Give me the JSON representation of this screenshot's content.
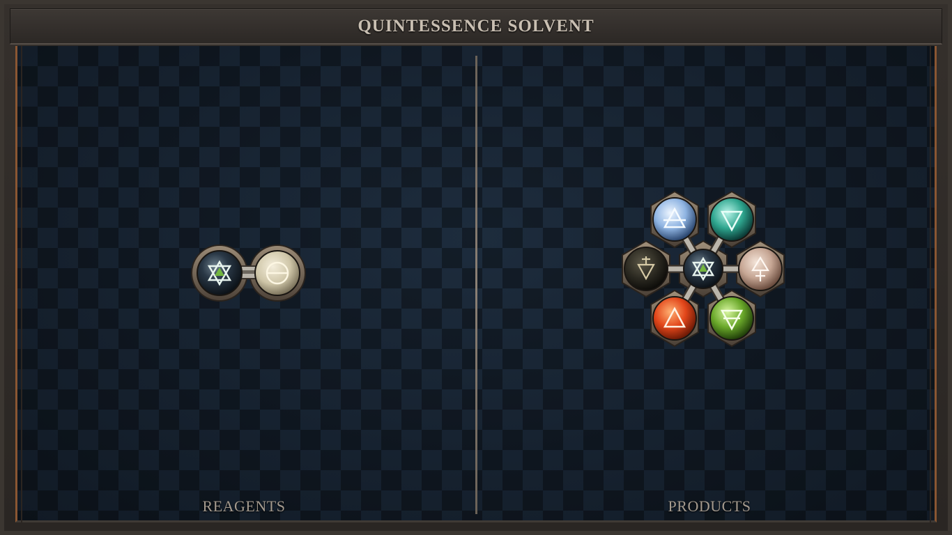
{
  "title": "QUINTESSENCE SOLVENT",
  "panels": {
    "reagents": {
      "label": "REAGENTS",
      "atoms": [
        {
          "element": "quintessence",
          "icon": "quintessence-icon",
          "color": "#3a4a58"
        },
        {
          "element": "salt",
          "icon": "salt-icon",
          "color": "#d8d0b8"
        }
      ]
    },
    "products": {
      "label": "PRODUCTS",
      "atoms": [
        {
          "element": "air",
          "icon": "air-icon",
          "color": "#a8c8ee"
        },
        {
          "element": "water",
          "icon": "water-icon",
          "color": "#3aa890"
        },
        {
          "element": "lead",
          "icon": "lead-icon",
          "color": "#2a2820"
        },
        {
          "element": "quintessence",
          "icon": "quintessence-icon",
          "color": "#3a4a58"
        },
        {
          "element": "vitae",
          "icon": "vitae-icon",
          "color": "#c8aa98"
        },
        {
          "element": "fire",
          "icon": "fire-icon",
          "color": "#e24d18"
        },
        {
          "element": "earth",
          "icon": "earth-icon",
          "color": "#6aa82a"
        }
      ]
    }
  },
  "colors": {
    "frame": "#3b3631",
    "board": "#152130",
    "accent_copper": "#8a5632",
    "label_text": "#a59b8f",
    "title_text": "#c9bfb2"
  }
}
